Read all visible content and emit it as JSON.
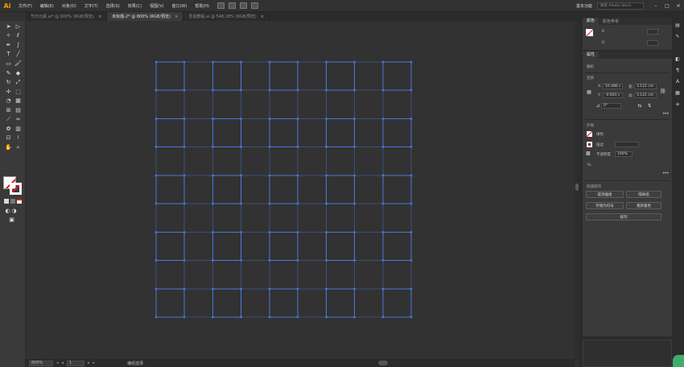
{
  "app": {
    "logo": "Ai"
  },
  "menu": [
    "文件(F)",
    "编辑(E)",
    "对象(O)",
    "文字(T)",
    "选择(S)",
    "效果(C)",
    "视图(V)",
    "窗口(W)",
    "帮助(H)"
  ],
  "workspace": "基本功能",
  "search_placeholder": "搜索 Adobe Stock",
  "window_controls": {
    "minimize": "–",
    "maximize": "□",
    "close": "✕"
  },
  "tabs": [
    {
      "label": "节日元素.ai* @ 600% (RGB/预览)",
      "active": false
    },
    {
      "label": "未标题-2* @ 800% (RGB/预览)",
      "active": true
    },
    {
      "label": "圣诞教程.ai @ 548.18% (RGB/预览)",
      "active": false
    }
  ],
  "tab_close": "×",
  "status": {
    "zoom": "800%",
    "page": "1",
    "mode": "编组选择",
    "prev_arrow": "◂",
    "next_arrow": "▸"
  },
  "color_panel": {
    "tabs": [
      "颜色",
      "颜色参考"
    ],
    "channel_r": "R",
    "channel_g": "G"
  },
  "properties": {
    "tab": "属性",
    "group_label": "编组",
    "transform_title": "变换",
    "x_label": "X:",
    "x_value": "10.486 c",
    "y_label": "Y:",
    "y_value": "-0.603 c",
    "w_label": "宽:",
    "w_value": "3.122 cm",
    "h_label": "高:",
    "h_value": "3.122 cm",
    "angle_value": "0°",
    "appearance_title": "外观",
    "fill_label": "填色",
    "stroke_label": "描边",
    "opacity_label": "不透明度",
    "opacity_value": "100%",
    "fx_label": "fx.",
    "quick_actions_title": "快速操作",
    "btn_ungroup": "取消编组",
    "btn_isolate": "隔离组",
    "btn_save_symbol": "存储为符号",
    "btn_recolor": "重新着色",
    "btn_arrange": "排列",
    "more": "•••"
  },
  "grid": {
    "columns": 5,
    "rows": 5,
    "color": "#4a78d8"
  },
  "colors": {
    "accent": "#ff9a00",
    "selection": "#4a78d8",
    "none_red": "#e2151b"
  }
}
